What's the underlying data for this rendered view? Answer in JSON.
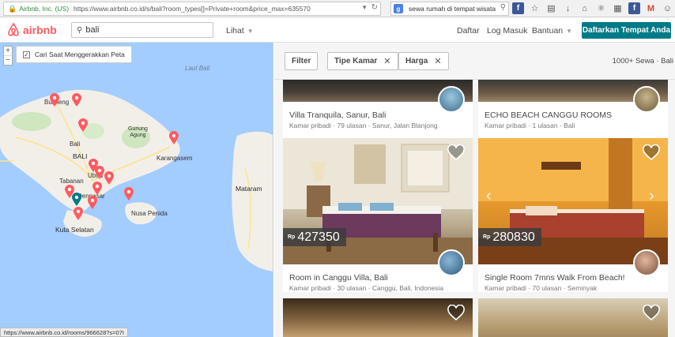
{
  "browser": {
    "site_identity": "Airbnb, Inc. (US)",
    "url": "https://www.airbnb.co.id/s/bali?room_types[]=Private+room&price_max=635570",
    "search_query": "sewa rumah di tempat wisata",
    "status_url": "https://www.airbnb.co.id/rooms/966628?s=07I"
  },
  "header": {
    "logo_text": "airbnb",
    "search_value": "bali",
    "browse_label": "Lihat",
    "signup_label": "Daftar",
    "login_label": "Log Masuk",
    "help_label": "Bantuan",
    "host_label": "Daftarkan Tempat Anda",
    "brand_color": "#ff5a5f",
    "cta_color": "#007a87"
  },
  "map": {
    "zoom_in": "+",
    "zoom_out": "−",
    "move_checkbox_label": "Cari Saat Menggerakkan Peta",
    "move_checked": true,
    "labels": {
      "sea": "Laut Bali",
      "gunung_agung": "Gunung\nAgung",
      "karangasem": "Karangasem",
      "bali": "Bali",
      "bali_caps": "BALI",
      "tabanan": "Tabanan",
      "ubud": "Ubud",
      "denpasar": "Denpasar",
      "kuta_selatan": "Kuta Selatan",
      "nusa_penida": "Nusa Penida",
      "mataram": "Mataram",
      "buleleng": "Buleleng"
    }
  },
  "filters": {
    "filter_button": "Filter",
    "room_type": "Tipe Kamar",
    "price": "Harga",
    "result_count": "1000+ Sewa · Bali"
  },
  "listings": [
    {
      "title": "Villa Tranquila, Sanur, Bali",
      "subtitle": "Kamar pribadi · 79 ulasan · Sanur, Jalan Blanjong"
    },
    {
      "title": "ECHO BEACH CANGGU ROOMS",
      "subtitle": "Kamar pribadi · 1 ulasan · Bali"
    },
    {
      "title": "Room in Canggu Villa, Bali",
      "subtitle": "Kamar pribadi · 30 ulasan · Canggu, Bali, Indonesia",
      "currency": "Rp",
      "price": "427350"
    },
    {
      "title": "Single Room 7mns Walk From Beach!",
      "subtitle": "Kamar pribadi · 70 ulasan · Seminyak",
      "currency": "Rp",
      "price": "280830"
    }
  ]
}
